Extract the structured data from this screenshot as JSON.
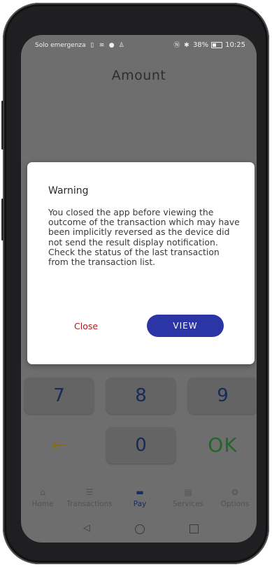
{
  "status_bar": {
    "carrier": "Solo emergenza",
    "battery": "38%",
    "time": "10:25",
    "battery_level": 0.38
  },
  "page": {
    "title": "Amount"
  },
  "keypad": {
    "row1": [
      "7",
      "8",
      "9"
    ],
    "back_symbol": "←",
    "zero": "0",
    "ok": "OK"
  },
  "tabs": [
    {
      "label": "Home",
      "icon": "home-icon"
    },
    {
      "label": "Transactions",
      "icon": "list-icon"
    },
    {
      "label": "Pay",
      "icon": "card-icon"
    },
    {
      "label": "Services",
      "icon": "clipboard-icon"
    },
    {
      "label": "Options",
      "icon": "gear-icon"
    }
  ],
  "active_tab": "Pay",
  "dialog": {
    "title": "Warning",
    "message": "You closed the app before viewing the outcome of the transaction which may have been implicitly reversed as the device did not send the result display notification. Check the status of the last transaction from the transaction list.",
    "close_label": "Close",
    "view_label": "VIEW"
  },
  "colors": {
    "dialog_view_button": "#2b35a6",
    "dialog_close_text": "#b01a1a",
    "ok_key": "#22662a",
    "back_key": "#8a6b1c"
  }
}
